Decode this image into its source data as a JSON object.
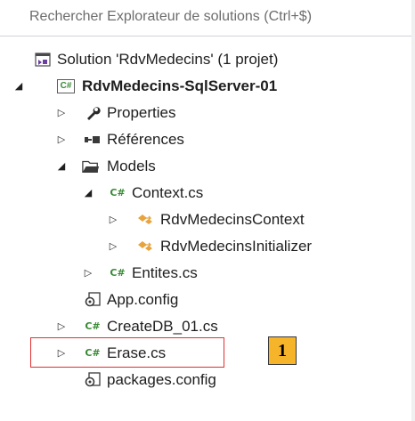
{
  "search": {
    "placeholder": "Rechercher Explorateur de solutions (Ctrl+$)"
  },
  "tree": {
    "items": [
      {
        "label": "Solution 'RdvMedecins' (1 projet)",
        "icon": "solution-icon",
        "expander": "none",
        "bold": false
      },
      {
        "label": "RdvMedecins-SqlServer-01",
        "icon": "csharp-project-icon",
        "expander": "expanded",
        "bold": true
      },
      {
        "label": "Properties",
        "icon": "wrench-icon",
        "expander": "collapsed",
        "bold": false
      },
      {
        "label": "Références",
        "icon": "references-icon",
        "expander": "collapsed",
        "bold": false
      },
      {
        "label": "Models",
        "icon": "folder-open-icon",
        "expander": "expanded",
        "bold": false
      },
      {
        "label": "Context.cs",
        "icon": "csharp-file-icon",
        "expander": "expanded",
        "bold": false
      },
      {
        "label": "RdvMedecinsContext",
        "icon": "class-icon",
        "expander": "collapsed",
        "bold": false
      },
      {
        "label": "RdvMedecinsInitializer",
        "icon": "class-icon",
        "expander": "collapsed",
        "bold": false
      },
      {
        "label": "Entites.cs",
        "icon": "csharp-file-icon",
        "expander": "collapsed",
        "bold": false
      },
      {
        "label": "App.config",
        "icon": "config-icon",
        "expander": "none",
        "bold": false
      },
      {
        "label": "CreateDB_01.cs",
        "icon": "csharp-file-icon",
        "expander": "collapsed",
        "bold": false
      },
      {
        "label": "Erase.cs",
        "icon": "csharp-file-icon",
        "expander": "collapsed",
        "bold": false
      },
      {
        "label": "packages.config",
        "icon": "config-icon",
        "expander": "none",
        "bold": false
      }
    ]
  },
  "callout": {
    "label": "1"
  },
  "glyphs": {
    "cs": "C#",
    "expanded": "◢",
    "collapsed": "▷"
  },
  "colors": {
    "highlight_border": "#e03030",
    "callout_fill": "#f5b429",
    "csharp_green": "#388a34",
    "class_orange": "#e8a33d"
  }
}
